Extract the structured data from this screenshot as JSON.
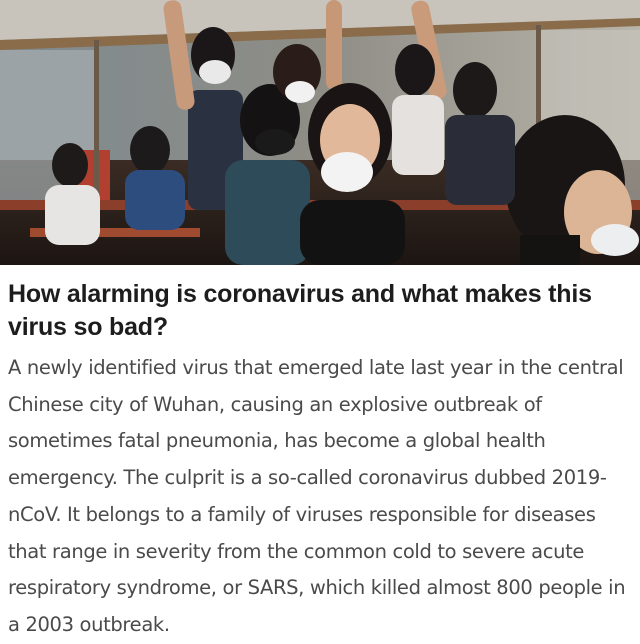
{
  "article": {
    "headline": "How alarming is coronavirus and what makes this virus so bad?",
    "body": "A newly identified virus that emerged late last year in the central Chinese city of Wuhan, causing an explosive outbreak of sometimes fatal pneumonia, has become a global health emergency. The culprit is a so-called coronavirus dubbed 2019-nCoV. It belongs to a family of viruses responsible for diseases that range in severity from the common cold to severe acute respiratory syndrome, or SARS, which killed almost 800 people in a 2003 outbreak."
  },
  "colors": {
    "headline": "#1d1d1d",
    "body": "#4a4a4a",
    "background": "#ffffff"
  }
}
